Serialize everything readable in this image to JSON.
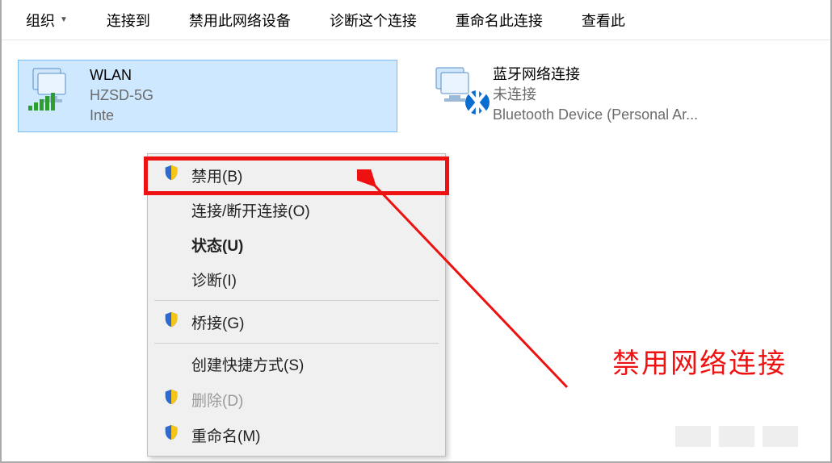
{
  "toolbar": {
    "organize": "组织",
    "connect_to": "连接到",
    "disable_device": "禁用此网络设备",
    "diagnose": "诊断这个连接",
    "rename": "重命名此连接",
    "view_status": "查看此"
  },
  "adapters": [
    {
      "title": "WLAN",
      "ssid": "HZSD-5G",
      "driver_prefix": "Inte",
      "selected": true,
      "kind": "wifi"
    },
    {
      "title": "蓝牙网络连接",
      "status": "未连接",
      "driver": "Bluetooth Device (Personal Ar...",
      "selected": false,
      "kind": "bluetooth"
    }
  ],
  "context_menu": {
    "items": [
      {
        "label": "禁用(B)",
        "shield": true,
        "highlighted": true
      },
      {
        "label": "连接/断开连接(O)"
      },
      {
        "label": "状态(U)",
        "bold": true
      },
      {
        "label": "诊断(I)"
      },
      {
        "sep": true
      },
      {
        "label": "桥接(G)",
        "shield": true
      },
      {
        "sep": true
      },
      {
        "label": "创建快捷方式(S)"
      },
      {
        "label": "删除(D)",
        "shield": true,
        "disabled": true
      },
      {
        "label": "重命名(M)",
        "shield": true
      }
    ]
  },
  "annotation": "禁用网络连接"
}
